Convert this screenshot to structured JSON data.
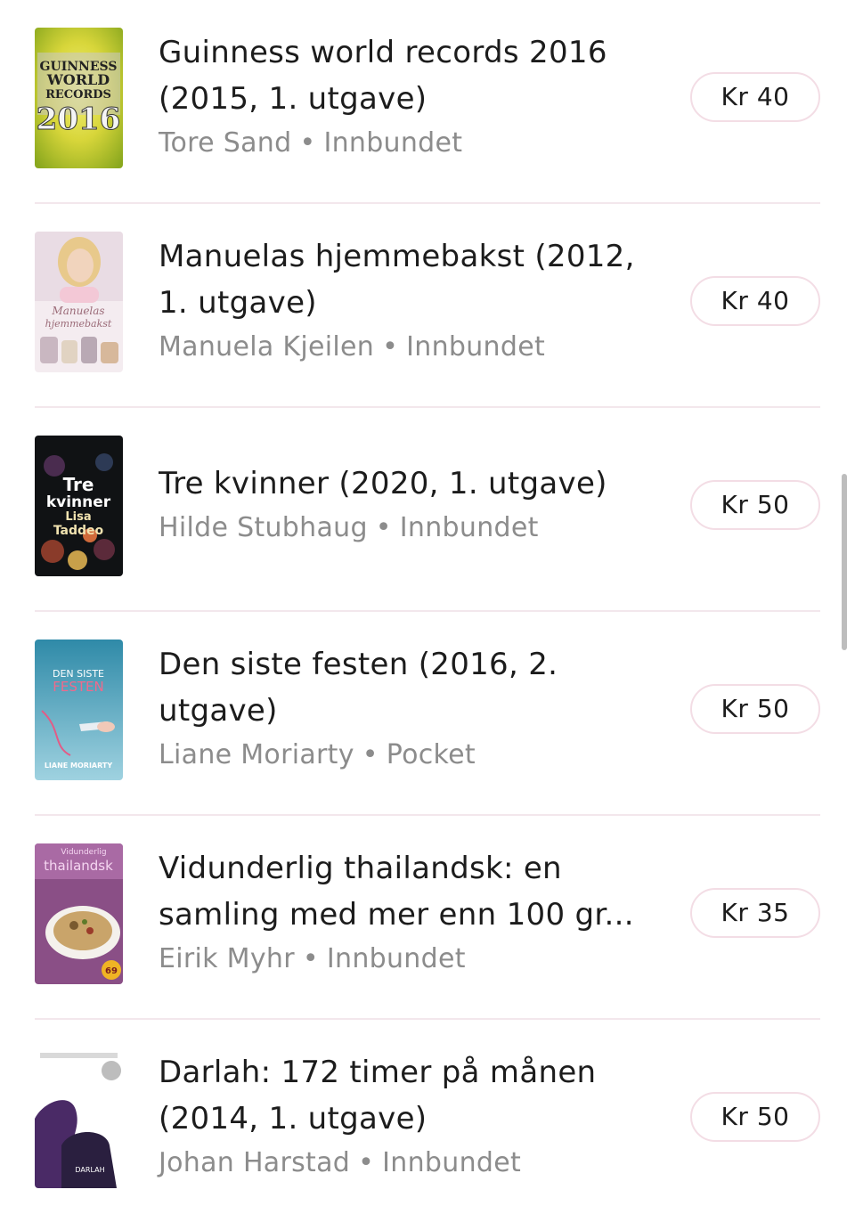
{
  "currency_label": "Kr",
  "colors": {
    "separator": "#f3e7ec",
    "price_border": "#f3dde5",
    "meta_text": "#8c8c8c"
  },
  "books": [
    {
      "title": "Guinness world records 2016 (2015, 1. utgave)",
      "author": "Tore Sand",
      "format": "Innbundet",
      "price": "Kr 40",
      "cover": {
        "icon": "guinness-cover",
        "lines": [
          "GUINNESS",
          "WORLD",
          "RECORDS",
          "2016"
        ]
      }
    },
    {
      "title": "Manuelas hjemmebakst (2012, 1. utgave)",
      "author": "Manuela Kjeilen",
      "format": "Innbundet",
      "price": "Kr 40",
      "cover": {
        "icon": "baking-cover",
        "lines": [
          "Manuelas",
          "hjemmebakst"
        ]
      }
    },
    {
      "title": "Tre kvinner (2020, 1. utgave)",
      "author": "Hilde Stubhaug",
      "format": "Innbundet",
      "price": "Kr 50",
      "cover": {
        "icon": "tre-kvinner-cover",
        "lines": [
          "Tre",
          "kvinner",
          "Lisa",
          "Taddeo"
        ]
      }
    },
    {
      "title": "Den siste festen (2016, 2. utgave)",
      "author": "Liane Moriarty",
      "format": "Pocket",
      "price": "Kr 50",
      "cover": {
        "icon": "siste-festen-cover",
        "lines": [
          "DEN SISTE",
          "FESTEN",
          "LIANE MORIARTY"
        ]
      }
    },
    {
      "title": "Vidunderlig thailandsk: en samling med mer enn 100 gr...",
      "author": "Eirik Myhr",
      "format": "Innbundet",
      "price": "Kr 35",
      "cover": {
        "icon": "thai-cookbook-cover",
        "lines": [
          "Vidunderlig",
          "thailandsk",
          "69"
        ]
      }
    },
    {
      "title": "Darlah: 172 timer på månen (2014, 1. utgave)",
      "author": "Johan Harstad",
      "format": "Innbundet",
      "price": "Kr 50",
      "cover": {
        "icon": "darlah-cover",
        "lines": [
          "DARLAH"
        ]
      }
    }
  ]
}
